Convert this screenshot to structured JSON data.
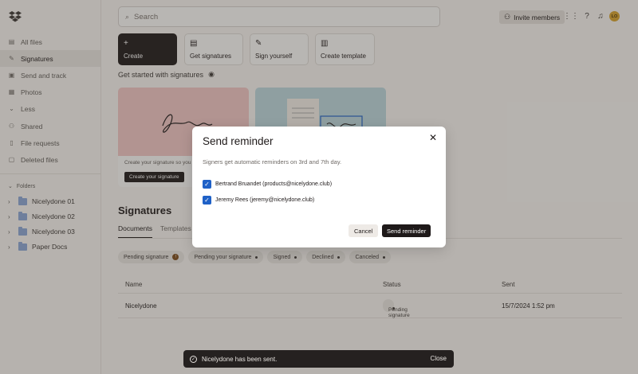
{
  "sidebar": {
    "items": [
      {
        "label": "All files",
        "icon": "folder-icon"
      },
      {
        "label": "Signatures",
        "icon": "signature-icon"
      },
      {
        "label": "Send and track",
        "icon": "send-icon"
      },
      {
        "label": "Photos",
        "icon": "photo-icon"
      },
      {
        "label": "Less",
        "icon": "chevron-up-icon"
      },
      {
        "label": "Shared",
        "icon": "shared-icon"
      },
      {
        "label": "File requests",
        "icon": "file-request-icon"
      },
      {
        "label": "Deleted files",
        "icon": "trash-icon"
      }
    ],
    "folders_heading": "Folders",
    "folders": [
      "Nicelydone 01",
      "Nicelydone 02",
      "Nicelydone 03",
      "Paper Docs"
    ]
  },
  "header": {
    "search_placeholder": "Search",
    "invite_label": "Invite members",
    "avatar_initials": "LO"
  },
  "tiles": [
    "Create",
    "Get signatures",
    "Sign yourself",
    "Create template"
  ],
  "get_started": "Get started with signatures",
  "cards": [
    {
      "text": "Create your signature so you",
      "button": "Create your signature"
    }
  ],
  "signatures": {
    "title": "Signatures",
    "tabs": [
      "Documents",
      "Templates"
    ],
    "filters": [
      "Pending signature",
      "Pending your signature",
      "Signed",
      "Declined",
      "Canceled"
    ],
    "pending_badge": "!",
    "columns": [
      "Name",
      "Status",
      "Sent"
    ],
    "rows": [
      {
        "name": "Nicelydone",
        "status": "Pending signature",
        "sent": "15/7/2024 1:52 pm"
      }
    ]
  },
  "modal": {
    "title": "Send reminder",
    "subtitle": "Signers get automatic reminders on 3rd and 7th day.",
    "signers": [
      "Bertrand Bruandet (products@nicelydone.club)",
      "Jeremy Rees (jeremy@nicelydone.club)"
    ],
    "cancel_label": "Cancel",
    "send_label": "Send reminder"
  },
  "toast": {
    "message": "Nicelydone has been sent.",
    "close_label": "Close"
  },
  "colors": {
    "accent": "#1f61c7",
    "dark": "#1e1919",
    "background": "#f7f5f2"
  }
}
